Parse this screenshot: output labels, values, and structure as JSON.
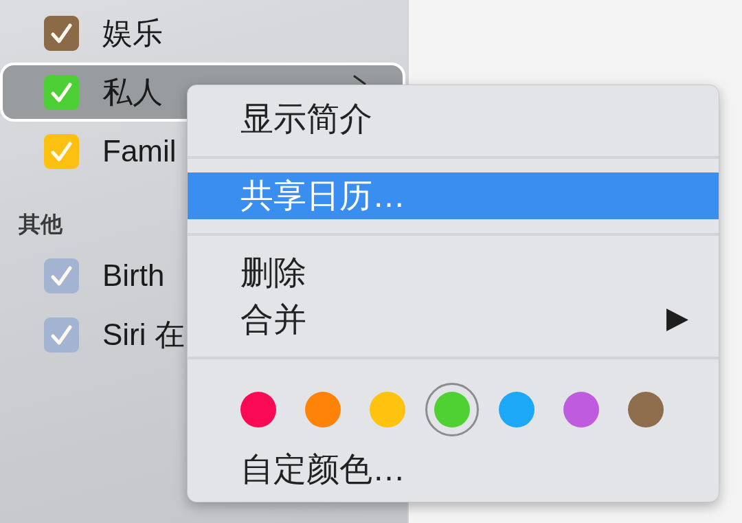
{
  "sidebar": {
    "groups": [
      {
        "items": [
          {
            "label": "娱乐",
            "checked": true,
            "color": "#8b6a48",
            "selected": false,
            "trailing_icon": false
          },
          {
            "label": "私人",
            "checked": true,
            "color": "#4ccf35",
            "selected": true,
            "trailing_icon": true
          },
          {
            "label": "Famil",
            "checked": true,
            "color": "#fcc010",
            "selected": false,
            "trailing_icon": false
          }
        ]
      },
      {
        "heading": "其他",
        "items": [
          {
            "label": "Birth",
            "checked": true,
            "color": "#a2b4d2",
            "selected": false,
            "trailing_icon": false
          },
          {
            "label": "Siri 在",
            "checked": true,
            "color": "#a2b4d2",
            "selected": false,
            "trailing_icon": false
          }
        ]
      }
    ]
  },
  "context_menu": {
    "sections": [
      {
        "kind": "items",
        "items": [
          {
            "label": "显示简介",
            "selected": false,
            "submenu": false
          }
        ]
      },
      {
        "kind": "items",
        "items": [
          {
            "label": "共享日历…",
            "selected": true,
            "submenu": false
          }
        ]
      },
      {
        "kind": "items",
        "items": [
          {
            "label": "删除",
            "selected": false,
            "submenu": false
          },
          {
            "label": "合并",
            "selected": false,
            "submenu": true
          }
        ]
      },
      {
        "kind": "colors",
        "swatches": [
          {
            "color": "#fa0a55",
            "selected": false
          },
          {
            "color": "#ff8308",
            "selected": false
          },
          {
            "color": "#ffc20e",
            "selected": false
          },
          {
            "color": "#4fd133",
            "selected": true
          },
          {
            "color": "#1ca8f5",
            "selected": false
          },
          {
            "color": "#bf5bdf",
            "selected": false
          },
          {
            "color": "#8e6e4c",
            "selected": false
          }
        ],
        "items": [
          {
            "label": "自定颜色…",
            "selected": false,
            "submenu": false
          }
        ]
      }
    ]
  }
}
